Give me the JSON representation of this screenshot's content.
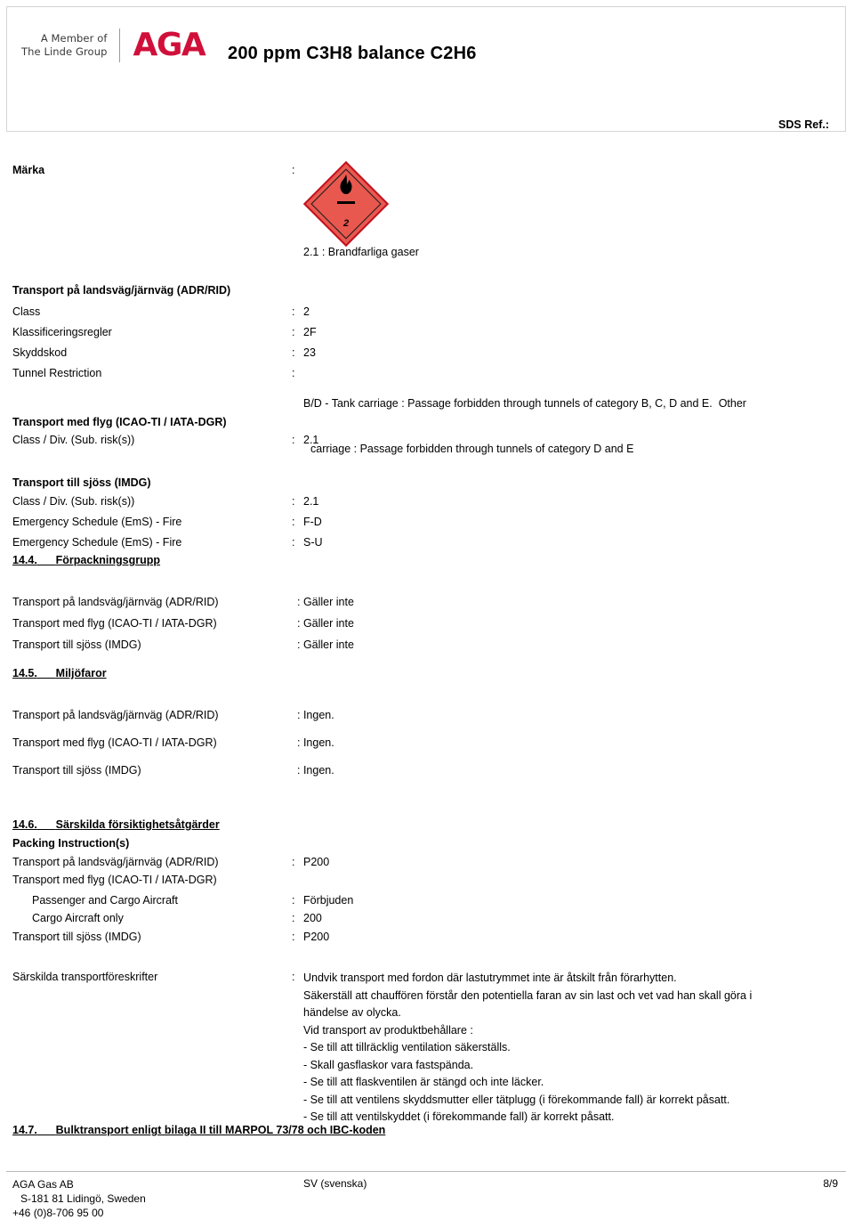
{
  "header": {
    "linde_line1": "A Member of",
    "linde_line2": "The Linde Group",
    "brand": "AGA",
    "brand_color": "#D0103A",
    "product_title": "200 ppm C3H8 balance C2H6",
    "sds_ref_label": "SDS Ref.:"
  },
  "marking": {
    "label": "Märka",
    "colon": ":",
    "pictogram": {
      "icon": "flammable-gas-flame-icon",
      "class_number": "2",
      "border_color": "#C1121F",
      "fill_color": "#E8584F"
    },
    "caption": "2.1 : Brandfarliga gaser"
  },
  "adr": {
    "heading": "Transport på landsväg/järnväg (ADR/RID)",
    "rows": [
      {
        "label": "Class",
        "colon": ":",
        "value": "2"
      },
      {
        "label": "Klassificeringsregler",
        "colon": ":",
        "value": "2F"
      },
      {
        "label": "Skyddskod",
        "colon": ":",
        "value": "23"
      },
      {
        "label": "Tunnel Restriction",
        "colon": ":",
        "value_line1": "B/D - Tank carriage : Passage forbidden through tunnels of category B, C, D and E.  Other",
        "value_line2": "carriage : Passage forbidden through tunnels of category D and E"
      }
    ]
  },
  "air": {
    "heading": "Transport med flyg (ICAO-TI / IATA-DGR)",
    "rows": [
      {
        "label": "Class / Div. (Sub. risk(s))",
        "colon": ":",
        "value": "2.1"
      }
    ]
  },
  "sea": {
    "heading": "Transport till sjöss (IMDG)",
    "rows": [
      {
        "label": "Class / Div. (Sub. risk(s))",
        "colon": ":",
        "value": "2.1"
      },
      {
        "label": "Emergency Schedule (EmS) - Fire",
        "colon": ":",
        "value": "F-D"
      },
      {
        "label": "Emergency Schedule (EmS) - Fire",
        "colon": ":",
        "value": "S-U"
      }
    ]
  },
  "section_14_4": {
    "number": "14.4.",
    "title": "Förpackningsgrupp",
    "rows": [
      {
        "label": "Transport på landsväg/järnväg (ADR/RID)",
        "value": ": Gäller inte"
      },
      {
        "label": "Transport med flyg (ICAO-TI / IATA-DGR)",
        "value": ": Gäller inte"
      },
      {
        "label": "Transport till sjöss (IMDG)",
        "value": ": Gäller inte"
      }
    ]
  },
  "section_14_5": {
    "number": "14.5.",
    "title": "Miljöfaror",
    "rows": [
      {
        "label": "Transport på landsväg/järnväg (ADR/RID)",
        "value": ": Ingen."
      },
      {
        "label": "Transport med flyg (ICAO-TI / IATA-DGR)",
        "value": ": Ingen."
      },
      {
        "label": "Transport till sjöss (IMDG)",
        "value": ": Ingen."
      }
    ]
  },
  "section_14_6": {
    "number": "14.6.",
    "title": "Särskilda försiktighetsåtgärder",
    "packing_heading": "Packing Instruction(s)",
    "rows": [
      {
        "label": "Transport på landsväg/järnväg (ADR/RID)",
        "colon": ":",
        "value": "P200",
        "indent": false
      },
      {
        "label": "Transport med flyg (ICAO-TI / IATA-DGR)",
        "colon": "",
        "value": "",
        "indent": false
      },
      {
        "label": "Passenger and Cargo Aircraft",
        "colon": ":",
        "value": "Förbjuden",
        "indent": true
      },
      {
        "label": "Cargo Aircraft only",
        "colon": ":",
        "value": "200",
        "indent": true
      },
      {
        "label": "Transport till sjöss (IMDG)",
        "colon": ":",
        "value": "P200",
        "indent": false
      }
    ],
    "special_label": "Särskilda transportföreskrifter",
    "special_colon": ":",
    "special_lines": [
      "Undvik transport med fordon där lastutrymmet inte är åtskilt från förarhytten.",
      "Säkerställ att chauffören förstår den potentiella faran av sin last och vet vad han skall göra i",
      "händelse av olycka.",
      "Vid transport av produktbehållare :",
      "- Se till att tillräcklig ventilation säkerställs.",
      "- Skall gasflaskor vara fastspända.",
      "- Se till att flaskventilen är stängd och inte läcker.",
      "- Se till att ventilens skyddsmutter eller tätplugg (i förekommande fall) är korrekt påsatt.",
      "- Se till att ventilskyddet (i förekommande fall) är korrekt påsatt."
    ]
  },
  "section_14_7": {
    "number": "14.7.",
    "title": "Bulktransport enligt bilaga II till MARPOL 73/78 och IBC-koden"
  },
  "footer": {
    "company": "AGA Gas AB",
    "address": "S-181 81 Lidingö, Sweden",
    "phone": "+46 (0)8-706 95 00",
    "language": "SV (svenska)",
    "page": "8/9"
  }
}
